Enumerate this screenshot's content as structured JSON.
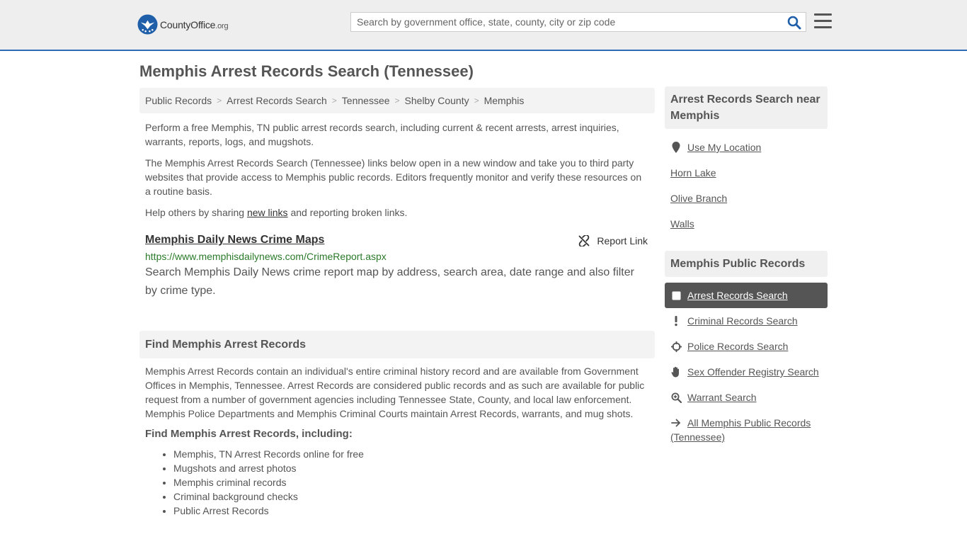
{
  "header": {
    "logo": {
      "brand": "CountyOffice",
      "tld": ".org"
    },
    "search_placeholder": "Search by government office, state, county, city or zip code",
    "icons": {
      "search": "search-icon",
      "menu": "hamburger-menu-icon"
    }
  },
  "page": {
    "title": "Memphis Arrest Records Search (Tennessee)"
  },
  "breadcrumb": [
    "Public Records",
    "Arrest Records Search",
    "Tennessee",
    "Shelby County",
    "Memphis"
  ],
  "intro": {
    "p1": "Perform a free Memphis, TN public arrest records search, including current & recent arrests, arrest inquiries, warrants, reports, logs, and mugshots.",
    "p2": "The Memphis Arrest Records Search (Tennessee) links below open in a new window and take you to third party websites that provide access to Memphis public records. Editors frequently monitor and verify these resources on a routine basis.",
    "p3_before": "Help others by sharing ",
    "p3_link": "new links",
    "p3_after": " and reporting broken links."
  },
  "link_entry": {
    "title": "Memphis Daily News Crime Maps",
    "report_label": "Report Link",
    "url": "https://www.memphisdailynews.com/CrimeReport.aspx",
    "description": "Search Memphis Daily News crime report map by address, search area, date range and also filter by crime type."
  },
  "find_section": {
    "heading": "Find Memphis Arrest Records",
    "body": "Memphis Arrest Records contain an individual's entire criminal history record and are available from Government Offices in Memphis, Tennessee. Arrest Records are considered public records and as such are available for public request from a number of government agencies including Tennessee State, County, and local law enforcement. Memphis Police Departments and Memphis Criminal Courts maintain Arrest Records, warrants, and mug shots.",
    "subheading": "Find Memphis Arrest Records, including:",
    "bullets": [
      "Memphis, TN Arrest Records online for free",
      "Mugshots and arrest photos",
      "Memphis criminal records",
      "Criminal background checks",
      "Public Arrest Records"
    ]
  },
  "sidebar": {
    "near_heading": "Arrest Records Search near Memphis",
    "near_items": [
      {
        "label": "Use My Location",
        "icon": "map-pin-icon"
      },
      {
        "label": "Horn Lake"
      },
      {
        "label": "Olive Branch"
      },
      {
        "label": "Walls"
      }
    ],
    "public_heading": "Memphis Public Records",
    "public_items": [
      {
        "label": "Arrest Records Search",
        "icon": "square-icon",
        "active": true
      },
      {
        "label": "Criminal Records Search",
        "icon": "exclamation-icon"
      },
      {
        "label": "Police Records Search",
        "icon": "crosshair-icon"
      },
      {
        "label": "Sex Offender Registry Search",
        "icon": "hand-stop-icon"
      },
      {
        "label": "Warrant Search",
        "icon": "magnifier-plus-icon"
      },
      {
        "label": "All Memphis Public Records (Tennessee)",
        "icon": "arrow-right-icon"
      }
    ]
  },
  "colors": {
    "accent_line": "#2b6cb5",
    "url_green": "#2a7a2a",
    "active_bg": "#555555",
    "panel_bg": "#f3f3f3"
  }
}
